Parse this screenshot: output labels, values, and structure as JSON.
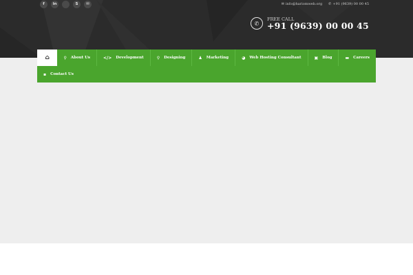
{
  "topbar": {
    "socials": [
      {
        "icon": "facebook-icon",
        "glyph": "f"
      },
      {
        "icon": "linkedin-icon",
        "glyph": "in"
      },
      {
        "icon": "blank-social-icon",
        "glyph": ""
      },
      {
        "icon": "skype-icon",
        "glyph": "S"
      },
      {
        "icon": "email-icon",
        "glyph": "✉"
      }
    ],
    "email": "info@hariomweb.org",
    "phone": "+91 (9639) 00 00 45"
  },
  "call": {
    "label": "FREE CALL",
    "number": "+91 (9639) 00 00 45"
  },
  "nav": {
    "items": [
      {
        "label": "About Us",
        "icon": "search-icon",
        "glyph": "⚲"
      },
      {
        "label": "Development",
        "icon": "code-icon",
        "glyph": "</>"
      },
      {
        "label": "Designing",
        "icon": "magnifier-icon",
        "glyph": "⚲"
      },
      {
        "label": "Marketing",
        "icon": "user-icon",
        "glyph": "♟"
      },
      {
        "label": "Web Hosting Consultant",
        "icon": "globe-icon",
        "glyph": "◕"
      },
      {
        "label": "Blog",
        "icon": "edit-icon",
        "glyph": "▣"
      },
      {
        "label": "Careers",
        "icon": "briefcase-icon",
        "glyph": "▬"
      }
    ],
    "contact": {
      "label": "Contact Us",
      "icon": "chat-icon",
      "glyph": "▪"
    }
  },
  "colors": {
    "header_bg": "#2b2b2b",
    "nav_green": "#4aa52d",
    "content_bg": "#eeeeee"
  }
}
